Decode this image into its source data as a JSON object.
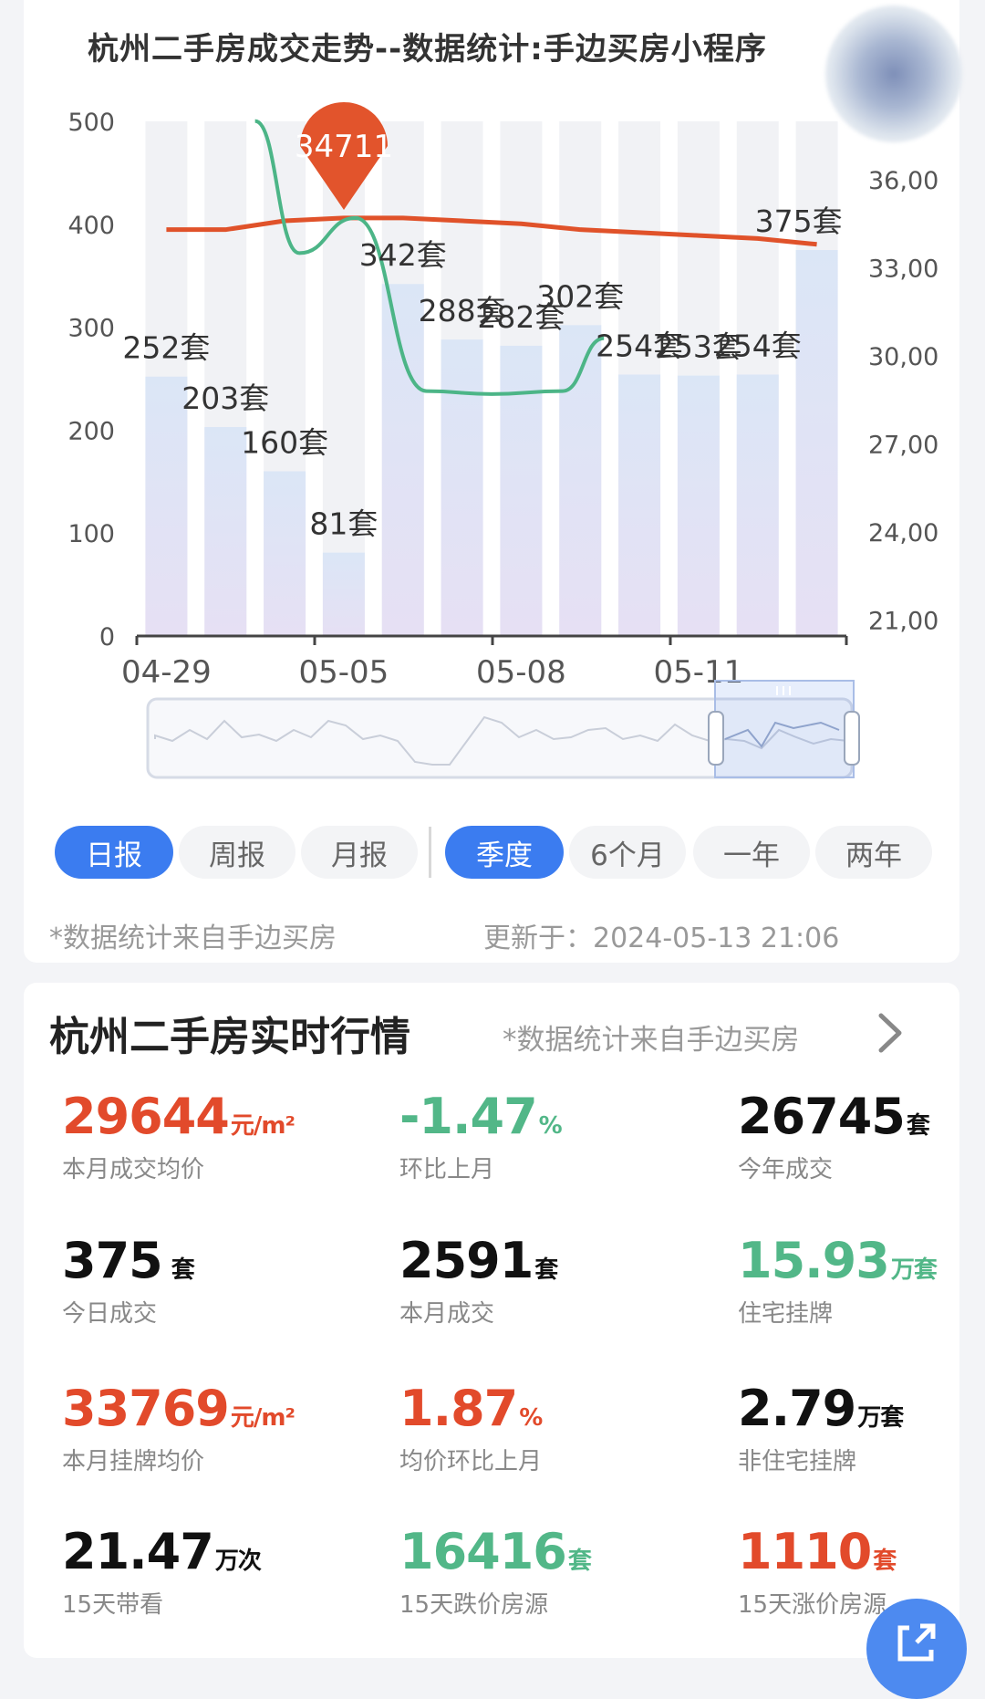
{
  "chart_section": {
    "title": "杭州二手房成交走势--数据统计:手边买房小程序",
    "tabs_period": [
      "日报",
      "周报",
      "月报"
    ],
    "tabs_range": [
      "季度",
      "6个月",
      "一年",
      "两年"
    ],
    "active_period": "日报",
    "active_range": "季度",
    "source_note": "*数据统计来自手边买房",
    "updated_note": "更新于：2024-05-13 21:06",
    "colors": {
      "bar": "#dde3f5",
      "price_line": "#e0522a",
      "listing_line": "#4cb587",
      "active_tab": "#3b7cf0"
    }
  },
  "chart_data": {
    "type": "bar",
    "x_tick_labels": [
      "04-29",
      "05-05",
      "05-08",
      "05-11"
    ],
    "ylim_left": [
      0,
      500
    ],
    "left_ticks": [
      "500",
      "400",
      "300",
      "200",
      "100",
      "0"
    ],
    "right_ticks": [
      "36,00",
      "33,00",
      "30,00",
      "27,00",
      "24,00",
      "21,00"
    ],
    "bar_values": [
      252,
      203,
      160,
      81,
      342,
      288,
      282,
      302,
      254,
      253,
      254,
      375
    ],
    "bar_labels": [
      "252套",
      "203套",
      "160套",
      "81套",
      "342套",
      "288套",
      "282套",
      "302套",
      "254套",
      "253套",
      "254套",
      "375套"
    ],
    "tooltip_value": "34711",
    "price_line_values": [
      34300,
      34300,
      34600,
      34700,
      34700,
      34600,
      34500,
      34300,
      34200,
      34100,
      34000,
      33800
    ],
    "green_line_values": [
      38000,
      33500,
      34700,
      28800,
      28700,
      28800,
      30600
    ],
    "grid": false,
    "legend": "none"
  },
  "market": {
    "title": "杭州二手房实时行情",
    "source": "*数据统计来自手边买房",
    "stats": [
      {
        "value": "29644",
        "unit": "元/m²",
        "label": "本月成交均价",
        "color": "#e24a2b"
      },
      {
        "value": "-1.47",
        "unit": "%",
        "label": "环比上月",
        "color": "#52b788"
      },
      {
        "value": "26745",
        "unit": "套",
        "label": "今年成交",
        "color": "#111111"
      },
      {
        "value": "375",
        "unit": " 套",
        "label": "今日成交",
        "color": "#111111"
      },
      {
        "value": "2591",
        "unit": "套",
        "label": "本月成交",
        "color": "#111111"
      },
      {
        "value": "15.93",
        "unit": "万套",
        "label": "住宅挂牌",
        "color": "#52b788"
      },
      {
        "value": "33769",
        "unit": "元/m²",
        "label": "本月挂牌均价",
        "color": "#e24a2b"
      },
      {
        "value": "1.87",
        "unit": "%",
        "label": "均价环比上月",
        "color": "#e24a2b"
      },
      {
        "value": "2.79",
        "unit": "万套",
        "label": "非住宅挂牌",
        "color": "#111111"
      },
      {
        "value": "21.47",
        "unit": "万次",
        "label": "15天带看",
        "color": "#111111"
      },
      {
        "value": "16416",
        "unit": "套",
        "label": "15天跌价房源",
        "color": "#52b788"
      },
      {
        "value": "1110",
        "unit": "套",
        "label": "15天涨价房源",
        "color": "#e24a2b"
      }
    ]
  }
}
